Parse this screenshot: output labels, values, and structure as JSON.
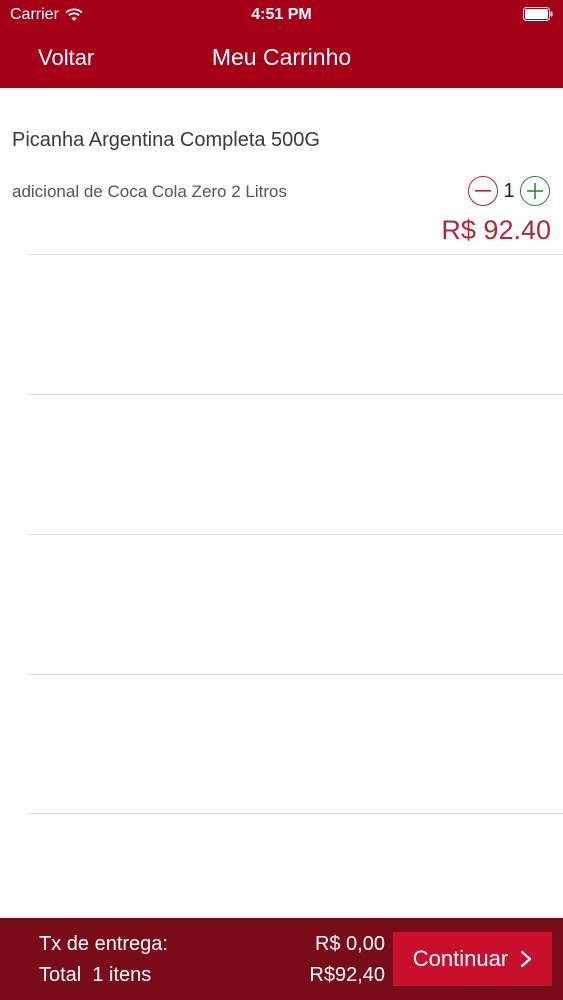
{
  "status_bar": {
    "carrier": "Carrier",
    "time": "4:51 PM"
  },
  "nav": {
    "back_label": "Voltar",
    "title": "Meu Carrinho"
  },
  "cart": {
    "items": [
      {
        "name": "Picanha Argentina Completa 500G",
        "addon": "adicional de Coca Cola Zero 2 Litros",
        "quantity": "1",
        "price": "R$ 92.40"
      }
    ]
  },
  "footer": {
    "delivery_label": "Tx de entrega:",
    "delivery_value": "R$ 0,00",
    "total_label": "Total  1 itens",
    "total_value": "R$92,40",
    "continue_label": "Continuar"
  },
  "colors": {
    "header_bg": "#a50018",
    "footer_bg": "#7a0c1a",
    "button_bg": "#c8102e",
    "price": "#b0283a",
    "minus": "#b0283a",
    "plus": "#2f8a35"
  }
}
